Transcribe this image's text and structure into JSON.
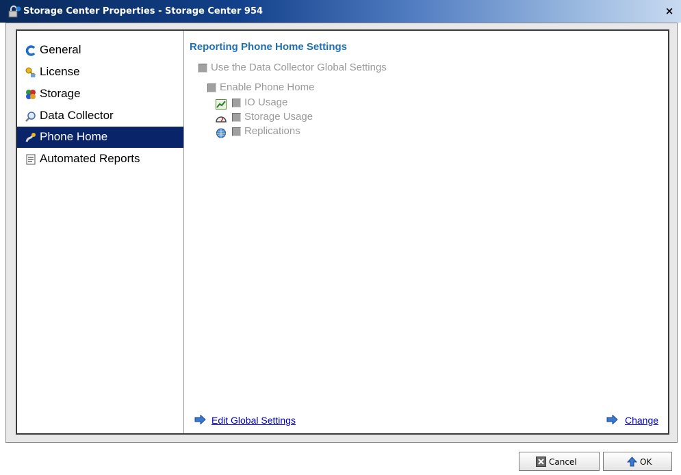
{
  "window": {
    "title": "Storage Center Properties - Storage Center 954",
    "close_label": "×"
  },
  "sidebar": {
    "items": [
      {
        "label": "General",
        "icon": "general-icon"
      },
      {
        "label": "License",
        "icon": "license-key-icon"
      },
      {
        "label": "Storage",
        "icon": "storage-icon"
      },
      {
        "label": "Data Collector",
        "icon": "data-collector-icon"
      },
      {
        "label": "Phone Home",
        "icon": "phone-home-icon",
        "selected": true
      },
      {
        "label": "Automated Reports",
        "icon": "report-icon"
      }
    ]
  },
  "content": {
    "heading": "Reporting Phone Home Settings",
    "use_global": {
      "label": "Use the Data Collector Global Settings",
      "checked": false,
      "enabled": false
    },
    "enable_phone_home": {
      "label": "Enable Phone Home",
      "checked": false,
      "enabled": false
    },
    "sub_options": [
      {
        "label": "IO Usage",
        "icon": "chart-icon",
        "checked": false
      },
      {
        "label": "Storage Usage",
        "icon": "gauge-icon",
        "checked": false
      },
      {
        "label": "Replications",
        "icon": "globe-icon",
        "checked": false
      }
    ],
    "edit_global_link": "Edit Global Settings",
    "change_link": "Change"
  },
  "footer": {
    "cancel_label": "Cancel",
    "ok_label": "OK"
  },
  "colors": {
    "selected_bg": "#0a246a",
    "heading": "#1e6fb5",
    "link": "#0000cc"
  }
}
